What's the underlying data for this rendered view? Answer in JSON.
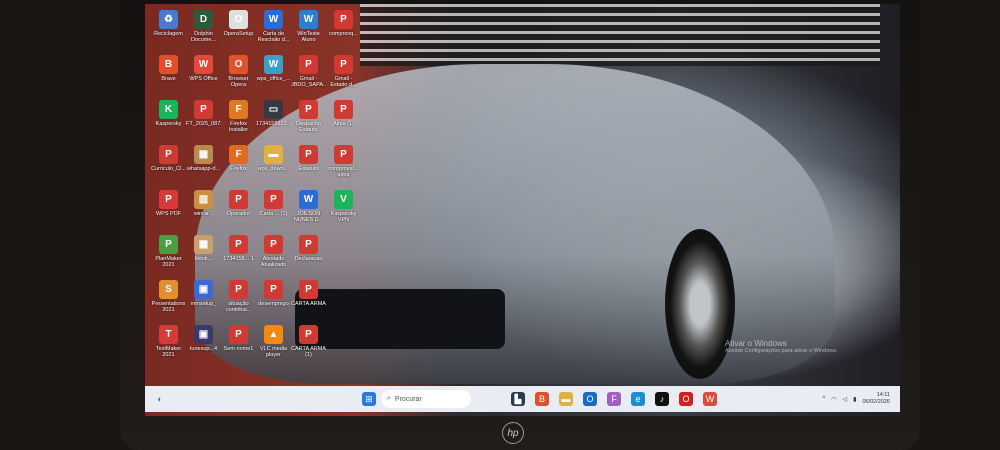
{
  "desktop_icons": [
    {
      "label": "Reciclagem",
      "color": "#4a7ad0",
      "glyph": "♻"
    },
    {
      "label": "Dolphin Docume...",
      "color": "#2d5a3a",
      "glyph": "D"
    },
    {
      "label": "OperaSetup",
      "color": "#e0e0e0",
      "glyph": "O"
    },
    {
      "label": "Carta de Rescisão d...",
      "color": "#2b6cd4",
      "glyph": "W"
    },
    {
      "label": "WinTeste Aluno",
      "color": "#2a7fd0",
      "glyph": "W"
    },
    {
      "label": "comprovq...",
      "color": "#d03a32",
      "glyph": "P"
    },
    {
      "label": "Brave",
      "color": "#e0502c",
      "glyph": "B"
    },
    {
      "label": "WPS Office",
      "color": "#e04a3a",
      "glyph": "W"
    },
    {
      "label": "Browser Opera",
      "color": "#e0542a",
      "glyph": "O"
    },
    {
      "label": "wps_office_...",
      "color": "#3aa0c8",
      "glyph": "W"
    },
    {
      "label": "Gmail - JBDO_SAPA...",
      "color": "#d03a32",
      "glyph": "P"
    },
    {
      "label": "Gmail - Estado d...",
      "color": "#d03a32",
      "glyph": "P"
    },
    {
      "label": "Kaspersky",
      "color": "#1bb45a",
      "glyph": "K"
    },
    {
      "label": "FT_2025_0872",
      "color": "#d03a32",
      "glyph": "P"
    },
    {
      "label": "Firefox Installer",
      "color": "#e07a20",
      "glyph": "F"
    },
    {
      "label": "1734158853...",
      "color": "#333a44",
      "glyph": "▭"
    },
    {
      "label": "Despacho Estauto",
      "color": "#d03a32",
      "glyph": "P"
    },
    {
      "label": "Alma (1)",
      "color": "#d03a32",
      "glyph": "P"
    },
    {
      "label": "Curriculo_Cl...",
      "color": "#d03a32",
      "glyph": "P"
    },
    {
      "label": "whatsapp-d...",
      "color": "#b88a50",
      "glyph": "▦"
    },
    {
      "label": "Firefox",
      "color": "#e06a20",
      "glyph": "F"
    },
    {
      "label": "wps_downl...",
      "color": "#e0b040",
      "glyph": "▬"
    },
    {
      "label": "Estatuto",
      "color": "#d03a32",
      "glyph": "P"
    },
    {
      "label": "comprovat... alma",
      "color": "#d03a32",
      "glyph": "P"
    },
    {
      "label": "WPS PDF",
      "color": "#d83a3a",
      "glyph": "P"
    },
    {
      "label": "winrar...",
      "color": "#c89040",
      "glyph": "▥"
    },
    {
      "label": "Operador",
      "color": "#d03a32",
      "glyph": "P"
    },
    {
      "label": "Carta ... (1)",
      "color": "#d03a32",
      "glyph": "P"
    },
    {
      "label": "JOILSON NUNES D...",
      "color": "#2b6cd4",
      "glyph": "W"
    },
    {
      "label": "Kaspersky VPN",
      "color": "#1bb45a",
      "glyph": "V"
    },
    {
      "label": "PlanMaker 2021",
      "color": "#4aa040",
      "glyph": "P"
    },
    {
      "label": "tiktok...",
      "color": "#c8a070",
      "glyph": "▦"
    },
    {
      "label": "1734158... 1",
      "color": "#d03a32",
      "glyph": "P"
    },
    {
      "label": "Atestado Atualizado",
      "color": "#d03a32",
      "glyph": "P"
    },
    {
      "label": "Declaracao",
      "color": "#d03a32",
      "glyph": "P"
    },
    {
      "label": "",
      "color": "transparent",
      "glyph": ""
    },
    {
      "label": "Presentations 2021",
      "color": "#e09030",
      "glyph": "S"
    },
    {
      "label": "mmsetup_",
      "color": "#3a6ad0",
      "glyph": "▣"
    },
    {
      "label": "situação contribui...",
      "color": "#d03a32",
      "glyph": "P"
    },
    {
      "label": "desemprego",
      "color": "#d03a32",
      "glyph": "P"
    },
    {
      "label": "CARTA ARMA",
      "color": "#d03a32",
      "glyph": "P"
    },
    {
      "label": "",
      "color": "transparent",
      "glyph": ""
    },
    {
      "label": "TextMaker 2021",
      "color": "#d83a3a",
      "glyph": "T"
    },
    {
      "label": "tunesup...4",
      "color": "#3a3a6a",
      "glyph": "▣"
    },
    {
      "label": "Sem nome1",
      "color": "#d03a32",
      "glyph": "P"
    },
    {
      "label": "VLC media player",
      "color": "#f08a10",
      "glyph": "▲"
    },
    {
      "label": "CARTA ARMA (1)",
      "color": "#d03a32",
      "glyph": "P"
    }
  ],
  "watermark": {
    "title": "Ativar o Windows",
    "subtitle": "Acesse Configurações para ativar o Windows."
  },
  "taskbar": {
    "search_placeholder": "Procurar",
    "apps": [
      {
        "name": "file-explorer-dark",
        "color": "#2a3a50",
        "glyph": "▙"
      },
      {
        "name": "brave",
        "color": "#e0502c",
        "glyph": "B"
      },
      {
        "name": "folder",
        "color": "#e0b040",
        "glyph": "▬"
      },
      {
        "name": "outlook",
        "color": "#1a6ac8",
        "glyph": "O"
      },
      {
        "name": "firefox",
        "color": "#a060c0",
        "glyph": "F"
      },
      {
        "name": "edge",
        "color": "#1a90d0",
        "glyph": "e"
      },
      {
        "name": "tiktok",
        "color": "#111111",
        "glyph": "♪"
      },
      {
        "name": "opera",
        "color": "#d02020",
        "glyph": "O"
      },
      {
        "name": "wps-office",
        "color": "#e04a3a",
        "glyph": "W"
      }
    ],
    "time": "14:11",
    "date": "06/02/2026"
  },
  "brand": "hp"
}
